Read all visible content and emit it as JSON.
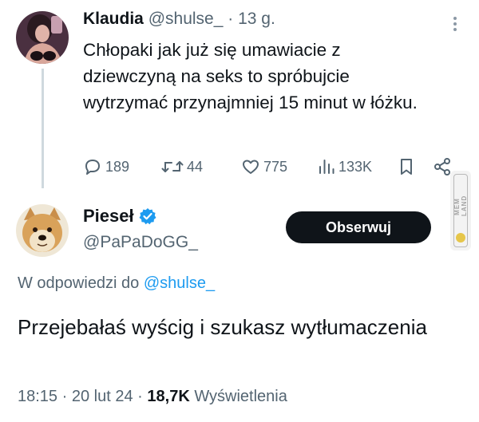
{
  "tweet": {
    "author_name": "Klaudia",
    "author_handle": "@shulse_",
    "separator": "·",
    "time": "13 g.",
    "text": "Chłopaki jak już się umawiacie z dziewczyną na seks to spróbujcie wytrzymać przynajmniej 15 minut w łóżku.",
    "replies": "189",
    "retweets": "44",
    "likes": "775",
    "views": "133K"
  },
  "reply": {
    "author_name": "Pieseł",
    "author_handle": "@PaPaDoGG_",
    "follow_label": "Obserwuj",
    "reply_prefix": "W odpowiedzi do",
    "reply_mention": "@shulse_",
    "text": "Przejebałaś wyścig i szukasz wytłumaczenia",
    "time": "18:15",
    "separator": "·",
    "date": "20 lut 24",
    "views_count": "18,7K",
    "views_label": "Wyświetlenia"
  },
  "watermark": {
    "text": "MEM LAND"
  },
  "colors": {
    "accent": "#1d9bf0",
    "muted": "#536471",
    "text": "#0f1419",
    "button_bg": "#0f1419"
  },
  "icons": [
    "more-icon",
    "reply-icon",
    "retweet-icon",
    "like-icon",
    "views-icon",
    "bookmark-icon",
    "share-icon",
    "verified-badge-icon"
  ]
}
